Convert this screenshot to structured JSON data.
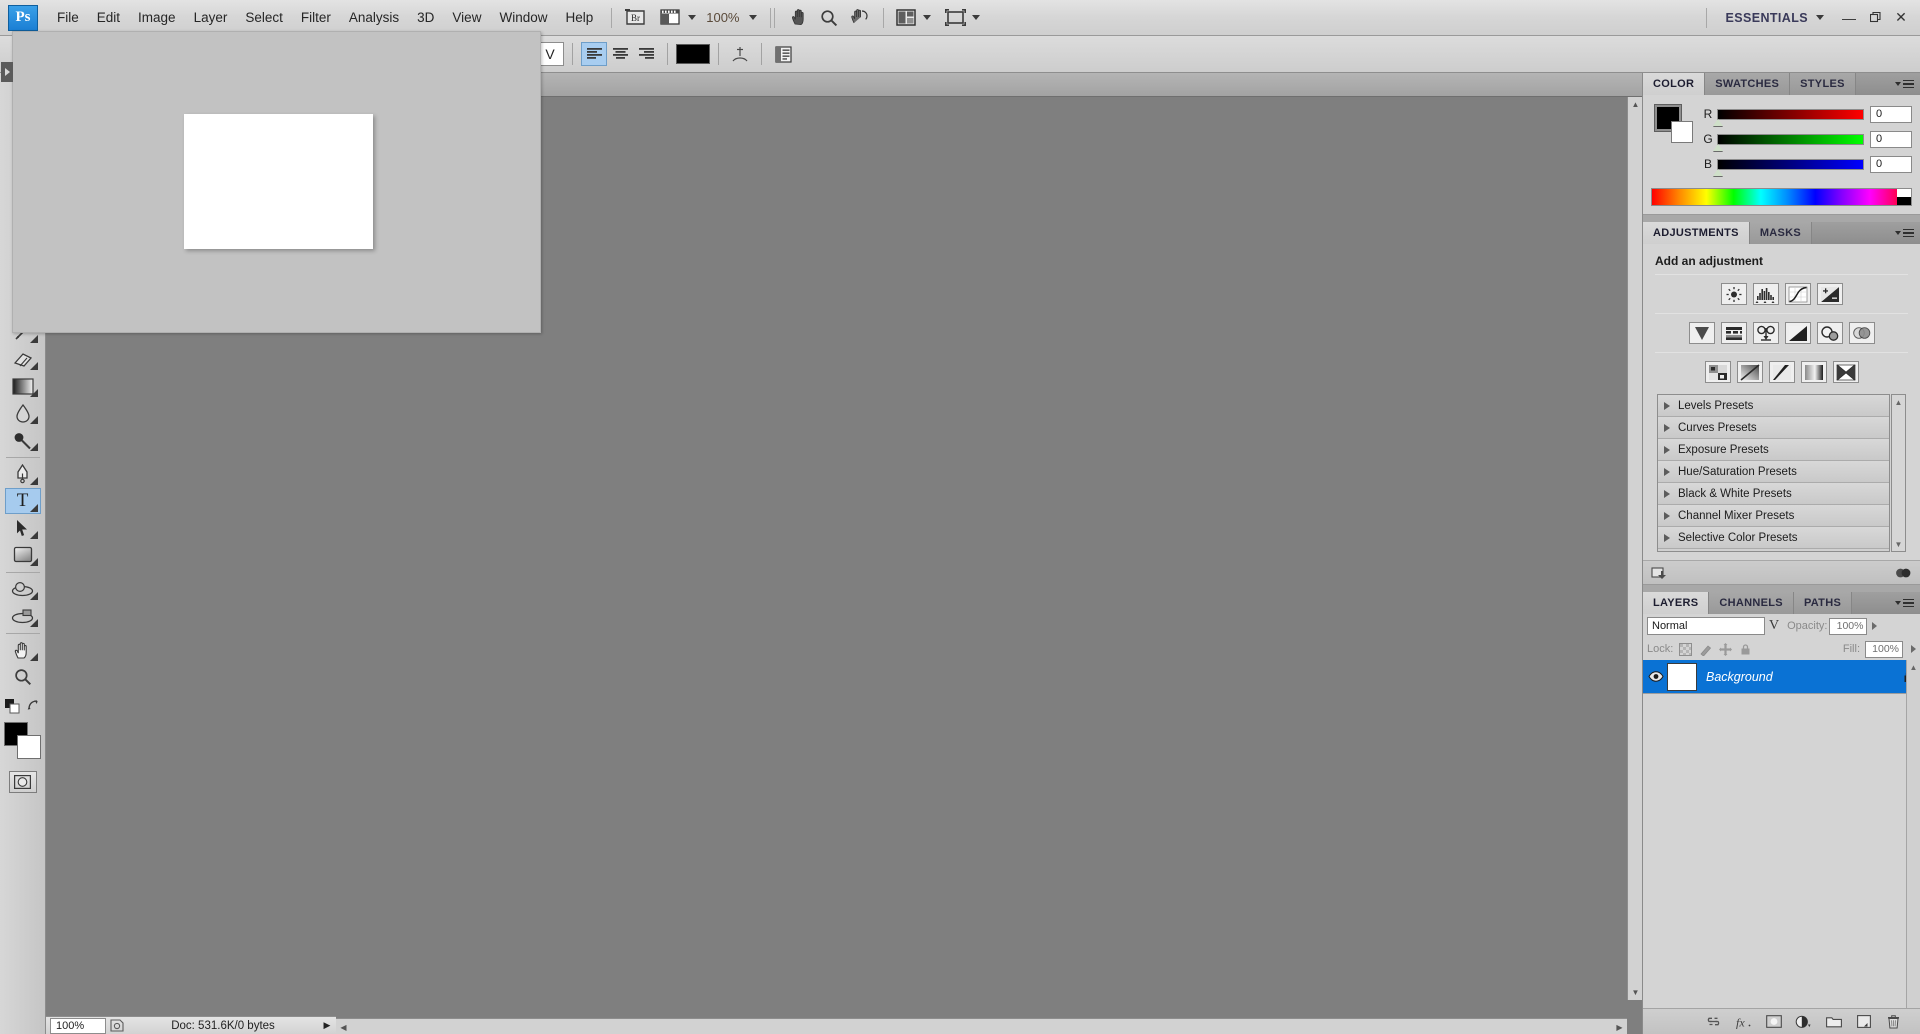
{
  "app": {
    "logo": "Ps",
    "title": "Adobe Photoshop"
  },
  "menubar": {
    "items": [
      "File",
      "Edit",
      "Image",
      "Layer",
      "Select",
      "Filter",
      "Analysis",
      "3D",
      "View",
      "Window",
      "Help"
    ],
    "bridge_label": "Br",
    "zoom_value": "100%",
    "icons": [
      "bridge-icon",
      "view-extras-icon",
      "hand-icon",
      "zoom-icon",
      "rotate-view-icon",
      "arrange-documents-icon",
      "screen-mode-icon"
    ],
    "workspace": "ESSENTIALS",
    "window_buttons": {
      "minimize": "—",
      "restore": "❐",
      "close": "✕"
    }
  },
  "optionsbar": {
    "font_style_value": "V",
    "align_left_label": "align-left",
    "align_center_label": "align-center",
    "align_right_label": "align-right",
    "text_color": "#000000",
    "warp_label": "create-warped-text",
    "panels_label": "toggle-character-paragraph-panels"
  },
  "toolbar": {
    "tools": [
      {
        "name": "healing-brush-tool",
        "glyph": "healing"
      },
      {
        "name": "eraser-tool",
        "glyph": "eraser"
      },
      {
        "name": "gradient-tool",
        "glyph": "gradient"
      },
      {
        "name": "blur-tool",
        "glyph": "blur"
      },
      {
        "name": "dodge-tool",
        "glyph": "dodge"
      },
      {
        "name": "pen-tool",
        "glyph": "pen"
      },
      {
        "name": "horizontal-type-tool",
        "glyph": "T",
        "active": true
      },
      {
        "name": "path-selection-tool",
        "glyph": "arrow"
      },
      {
        "name": "rectangle-tool",
        "glyph": "rect"
      },
      {
        "name": "3d-rotate-tool",
        "glyph": "rotate3d"
      },
      {
        "name": "3d-camera-tool",
        "glyph": "camera3d"
      },
      {
        "name": "hand-tool",
        "glyph": "hand"
      },
      {
        "name": "zoom-tool",
        "glyph": "zoom"
      }
    ],
    "foreground_color": "#000000",
    "background_color": "#ffffff",
    "quick_mask_label": "edit-in-quick-mask-mode"
  },
  "statusbar": {
    "zoom": "100%",
    "doc_info": "Doc: 531.6K/0 bytes"
  },
  "panels": {
    "color": {
      "tabs": [
        "COLOR",
        "SWATCHES",
        "STYLES"
      ],
      "active_tab": "COLOR",
      "foreground": "#000000",
      "background": "#ffffff",
      "channels": [
        {
          "label": "R",
          "value": "0",
          "color": "#ff0000"
        },
        {
          "label": "G",
          "value": "0",
          "color": "#00ff00"
        },
        {
          "label": "B",
          "value": "0",
          "color": "#0000ff"
        }
      ]
    },
    "adjustments": {
      "tabs": [
        "ADJUSTMENTS",
        "MASKS"
      ],
      "active_tab": "ADJUSTMENTS",
      "heading": "Add an adjustment",
      "row1": [
        "brightness-contrast-icon",
        "levels-icon",
        "curves-icon",
        "exposure-icon"
      ],
      "row2": [
        "vibrance-icon",
        "hue-saturation-icon",
        "color-balance-icon",
        "black-white-icon",
        "photo-filter-icon",
        "channel-mixer-icon"
      ],
      "row3": [
        "invert-icon",
        "posterize-icon",
        "threshold-icon",
        "gradient-map-icon",
        "selective-color-icon"
      ],
      "presets": [
        "Levels Presets",
        "Curves Presets",
        "Exposure Presets",
        "Hue/Saturation Presets",
        "Black & White Presets",
        "Channel Mixer Presets",
        "Selective Color Presets"
      ],
      "footer_left_icon": "return-to-adjustment-list-icon",
      "footer_right_icon": "delete-adjustment-icon"
    },
    "layers": {
      "tabs": [
        "LAYERS",
        "CHANNELS",
        "PATHS"
      ],
      "active_tab": "LAYERS",
      "blend_mode": "Normal",
      "opacity_label": "Opacity:",
      "opacity_value": "100%",
      "lock_label": "Lock:",
      "lock_icons": [
        "lock-transparent-pixels-icon",
        "lock-image-pixels-icon",
        "lock-position-icon",
        "lock-all-icon"
      ],
      "fill_label": "Fill:",
      "fill_value": "100%",
      "items": [
        {
          "name": "Background",
          "visible": true,
          "locked": true,
          "selected": true
        }
      ],
      "footer_icons": [
        "link-layers-icon",
        "layer-style-fx-icon",
        "add-layer-mask-icon",
        "new-fill-adjustment-layer-icon",
        "new-group-icon",
        "new-layer-icon",
        "delete-layer-icon"
      ]
    }
  },
  "overlay": {
    "name": "floating-document-window",
    "canvas_color": "#ffffff",
    "background_color": "#c2c2c2"
  }
}
